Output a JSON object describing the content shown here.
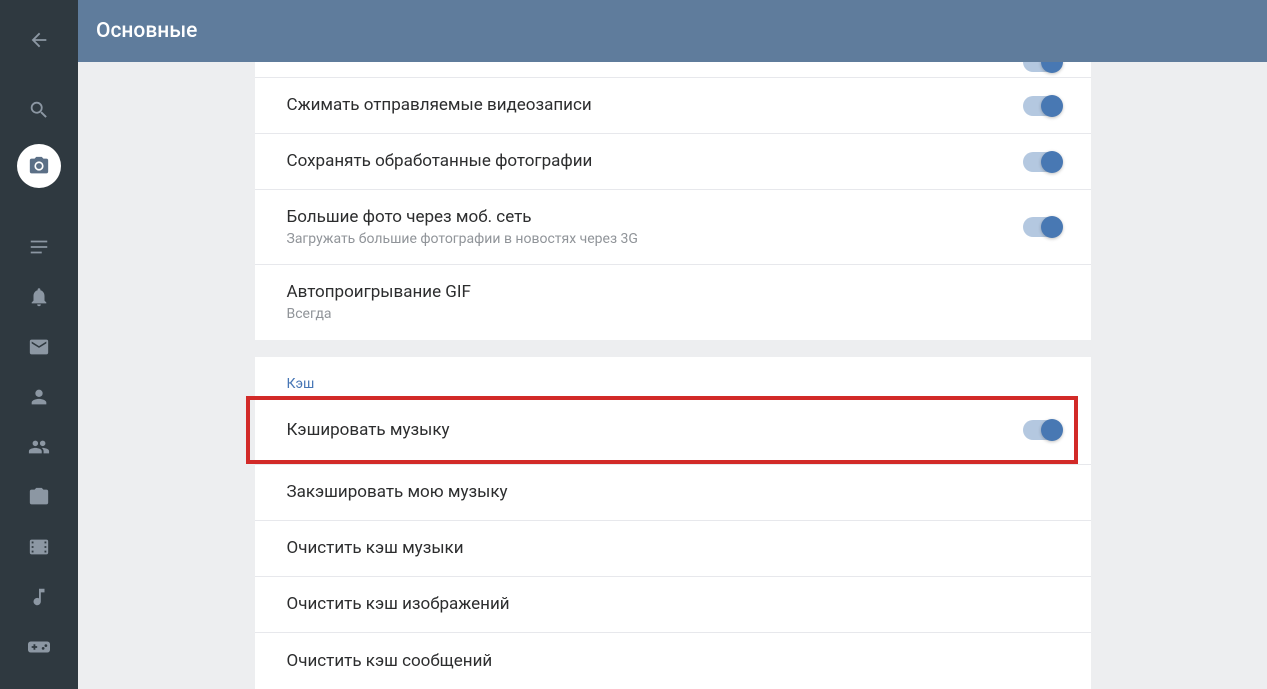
{
  "header": {
    "title": "Основные"
  },
  "rows": {
    "compress_video": "Сжимать отправляемые видеозаписи",
    "save_photos": "Сохранять обработанные фотографии",
    "big_photos_title": "Большие фото через моб. сеть",
    "big_photos_sub": "Загружать большие фотографии в новостях через 3G",
    "autoplay_gif_title": "Автопроигрывание GIF",
    "autoplay_gif_sub": "Всегда"
  },
  "cache_section": {
    "title": "Кэш",
    "cache_music": "Кэшировать музыку",
    "cache_my_music": "Закэшировать мою музыку",
    "clear_music": "Очистить кэш музыки",
    "clear_images": "Очистить кэш изображений",
    "clear_messages": "Очистить кэш сообщений"
  }
}
